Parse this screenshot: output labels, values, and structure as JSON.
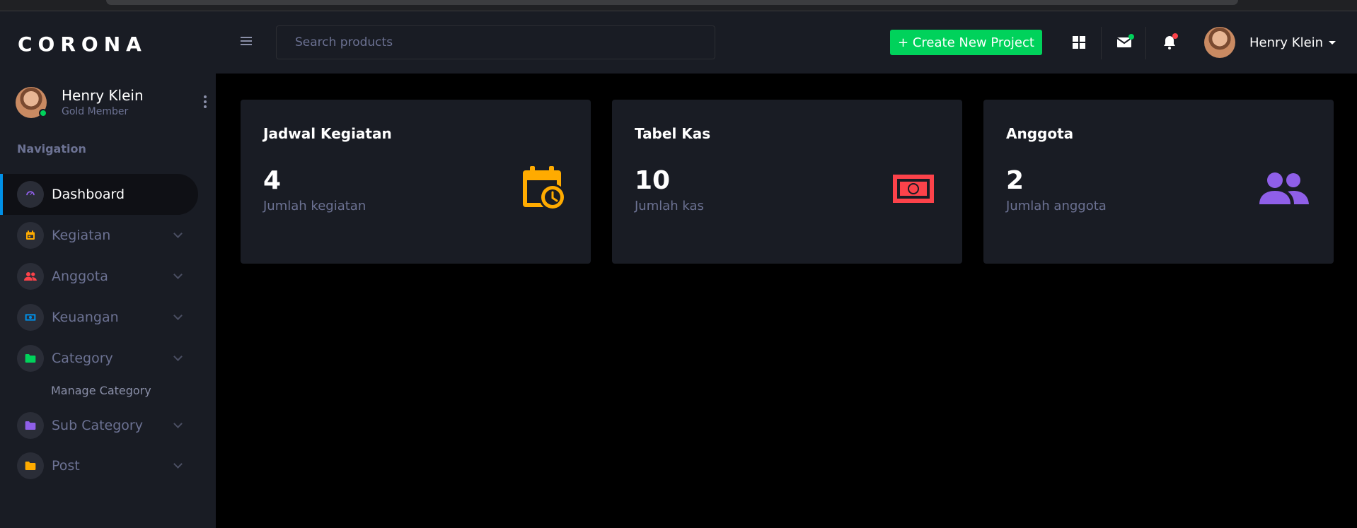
{
  "brand": {
    "name": "CORONA"
  },
  "user": {
    "name": "Henry Klein",
    "role": "Gold Member"
  },
  "sidebar": {
    "heading": "Navigation",
    "items": [
      {
        "label": "Dashboard",
        "icon": "speedometer-icon",
        "active": true
      },
      {
        "label": "Kegiatan",
        "icon": "calendar-icon"
      },
      {
        "label": "Anggota",
        "icon": "people-icon"
      },
      {
        "label": "Keuangan",
        "icon": "cash-icon"
      },
      {
        "label": "Category",
        "icon": "folder-icon"
      },
      {
        "label": "Sub Category",
        "icon": "folder-icon"
      },
      {
        "label": "Post",
        "icon": "folder-icon"
      }
    ],
    "sub_items": {
      "category": "Manage Category"
    }
  },
  "topbar": {
    "search_placeholder": "Search products",
    "create_label": "+ Create New Project",
    "user_name": "Henry Klein"
  },
  "cards": [
    {
      "title": "Jadwal Kegiatan",
      "value": "4",
      "subtitle": "Jumlah kegiatan",
      "icon": "calendar-clock-icon",
      "color": "#ffab00"
    },
    {
      "title": "Tabel Kas",
      "value": "10",
      "subtitle": "Jumlah kas",
      "icon": "cash-icon",
      "color": "#fc424a"
    },
    {
      "title": "Anggota",
      "value": "2",
      "subtitle": "Jumlah anggota",
      "icon": "people-icon",
      "color": "#8f5fe8"
    }
  ],
  "colors": {
    "success": "#00d25b",
    "danger": "#fc424a",
    "warning": "#ffab00",
    "primary": "#0090e7",
    "purple": "#8f5fe8",
    "sidebar_bg": "#191c24"
  }
}
